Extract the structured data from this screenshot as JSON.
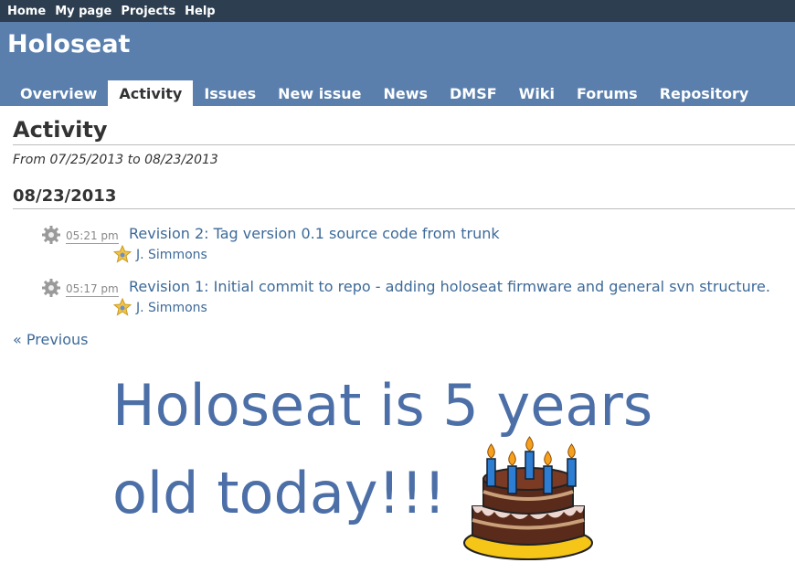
{
  "top_menu": [
    "Home",
    "My page",
    "Projects",
    "Help"
  ],
  "project": {
    "title": "Holoseat"
  },
  "tabs": [
    {
      "label": "Overview"
    },
    {
      "label": "Activity",
      "selected": true
    },
    {
      "label": "Issues"
    },
    {
      "label": "New issue"
    },
    {
      "label": "News"
    },
    {
      "label": "DMSF"
    },
    {
      "label": "Wiki"
    },
    {
      "label": "Forums"
    },
    {
      "label": "Repository"
    }
  ],
  "page": {
    "title": "Activity",
    "date_range": "From 07/25/2013 to 08/23/2013",
    "day": "08/23/2013",
    "events": [
      {
        "time": "05:21 pm",
        "title": "Revision 2: Tag version 0.1 source code from trunk",
        "author": "J. Simmons"
      },
      {
        "time": "05:17 pm",
        "title": "Revision 1: Initial commit to repo - adding holoseat firmware and general svn structure.",
        "author": "J. Simmons"
      }
    ],
    "pager_prev": "« Previous"
  },
  "banner": {
    "line1": "Holoseat is 5 years",
    "line2": "old today!!!"
  },
  "icons": {
    "event": "gear-icon",
    "author": "star-icon",
    "image": "birthday-cake"
  },
  "colors": {
    "header": "#5a7fad",
    "top_menu": "#2c3e50",
    "link": "#3d6a99",
    "banner": "#4c6fa7"
  }
}
